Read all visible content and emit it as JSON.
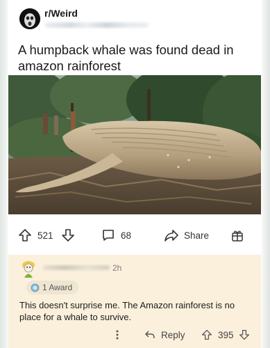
{
  "post": {
    "subreddit": "r/Weird",
    "title": "A humpback whale was found dead in amazon rainforest",
    "upvotes": "521",
    "comments": "68",
    "share_label": "Share"
  },
  "comment": {
    "time": "2h",
    "award_label": "1 Award",
    "text": "This doesn't surprise me. The Amazon rainforest is no place for a whale to survive.",
    "reply_label": "Reply",
    "upvotes": "395"
  },
  "icons": {
    "subreddit_avatar": "face-icon",
    "upvote": "arrow-up-icon",
    "downvote": "arrow-down-icon",
    "comment": "speech-bubble-icon",
    "share": "share-arrow-icon",
    "award": "gift-icon",
    "more": "more-vertical-icon",
    "reply": "reply-icon"
  },
  "colors": {
    "comment_bg": "#fbf0dc",
    "text": "#1a1a1b"
  }
}
